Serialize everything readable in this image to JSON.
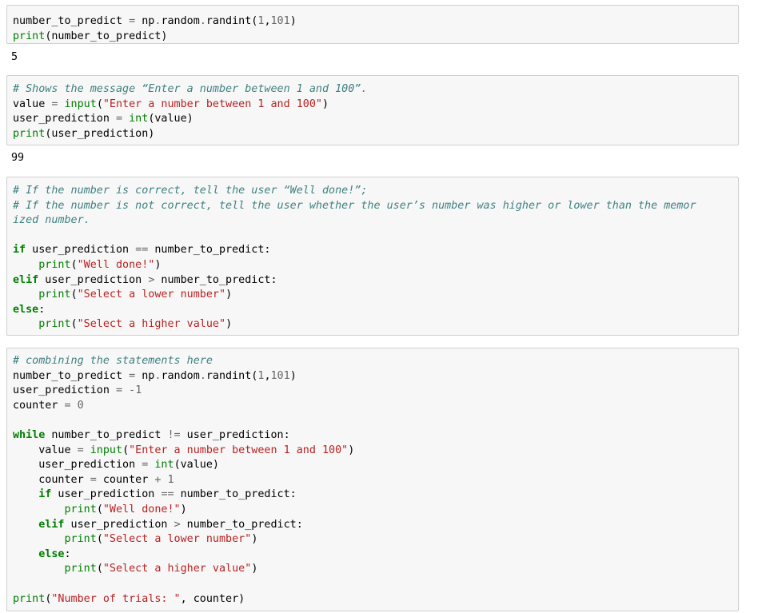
{
  "cells": [
    {
      "lines": [
        [
          {
            "t": "n",
            "v": "number_to_predict "
          },
          {
            "t": "o",
            "v": "="
          },
          {
            "t": "n",
            "v": " np"
          },
          {
            "t": "o",
            "v": "."
          },
          {
            "t": "n",
            "v": "random"
          },
          {
            "t": "o",
            "v": "."
          },
          {
            "t": "n",
            "v": "randint("
          },
          {
            "t": "m",
            "v": "1"
          },
          {
            "t": "n",
            "v": ","
          },
          {
            "t": "m",
            "v": "101"
          },
          {
            "t": "n",
            "v": ")"
          }
        ],
        [
          {
            "t": "b",
            "v": "print"
          },
          {
            "t": "n",
            "v": "(number_to_predict)"
          }
        ]
      ],
      "output": "5"
    },
    {
      "lines": [
        [
          {
            "t": "c",
            "v": "# Shows the message “Enter a number between 1 and 100”."
          }
        ],
        [
          {
            "t": "n",
            "v": "value "
          },
          {
            "t": "o",
            "v": "="
          },
          {
            "t": "n",
            "v": " "
          },
          {
            "t": "b",
            "v": "input"
          },
          {
            "t": "n",
            "v": "("
          },
          {
            "t": "s",
            "v": "\"Enter a number between 1 and 100\""
          },
          {
            "t": "n",
            "v": ")"
          }
        ],
        [
          {
            "t": "n",
            "v": "user_prediction "
          },
          {
            "t": "o",
            "v": "="
          },
          {
            "t": "n",
            "v": " "
          },
          {
            "t": "b",
            "v": "int"
          },
          {
            "t": "n",
            "v": "(value)"
          }
        ],
        [
          {
            "t": "b",
            "v": "print"
          },
          {
            "t": "n",
            "v": "(user_prediction)"
          }
        ]
      ],
      "output": "99"
    },
    {
      "lines": [
        [
          {
            "t": "c",
            "v": "# If the number is correct, tell the user “Well done!”;"
          }
        ],
        [
          {
            "t": "c",
            "v": "# If the number is not correct, tell the user whether the user’s number was higher or lower than the memor"
          }
        ],
        [
          {
            "t": "c",
            "v": "ized number."
          }
        ],
        [],
        [
          {
            "t": "k",
            "v": "if"
          },
          {
            "t": "n",
            "v": " user_prediction "
          },
          {
            "t": "o",
            "v": "=="
          },
          {
            "t": "n",
            "v": " number_to_predict:"
          }
        ],
        [
          {
            "t": "n",
            "v": "    "
          },
          {
            "t": "b",
            "v": "print"
          },
          {
            "t": "n",
            "v": "("
          },
          {
            "t": "s",
            "v": "\"Well done!\""
          },
          {
            "t": "n",
            "v": ")"
          }
        ],
        [
          {
            "t": "k",
            "v": "elif"
          },
          {
            "t": "n",
            "v": " user_prediction "
          },
          {
            "t": "o",
            "v": ">"
          },
          {
            "t": "n",
            "v": " number_to_predict:"
          }
        ],
        [
          {
            "t": "n",
            "v": "    "
          },
          {
            "t": "b",
            "v": "print"
          },
          {
            "t": "n",
            "v": "("
          },
          {
            "t": "s",
            "v": "\"Select a lower number\""
          },
          {
            "t": "n",
            "v": ")"
          }
        ],
        [
          {
            "t": "k",
            "v": "else"
          },
          {
            "t": "n",
            "v": ":"
          }
        ],
        [
          {
            "t": "n",
            "v": "    "
          },
          {
            "t": "b",
            "v": "print"
          },
          {
            "t": "n",
            "v": "("
          },
          {
            "t": "s",
            "v": "\"Select a higher value\""
          },
          {
            "t": "n",
            "v": ")"
          }
        ]
      ],
      "output": null
    },
    {
      "lines": [
        [
          {
            "t": "c",
            "v": "# combining the statements here"
          }
        ],
        [
          {
            "t": "n",
            "v": "number_to_predict "
          },
          {
            "t": "o",
            "v": "="
          },
          {
            "t": "n",
            "v": " np"
          },
          {
            "t": "o",
            "v": "."
          },
          {
            "t": "n",
            "v": "random"
          },
          {
            "t": "o",
            "v": "."
          },
          {
            "t": "n",
            "v": "randint("
          },
          {
            "t": "m",
            "v": "1"
          },
          {
            "t": "n",
            "v": ","
          },
          {
            "t": "m",
            "v": "101"
          },
          {
            "t": "n",
            "v": ")"
          }
        ],
        [
          {
            "t": "n",
            "v": "user_prediction "
          },
          {
            "t": "o",
            "v": "="
          },
          {
            "t": "n",
            "v": " "
          },
          {
            "t": "o",
            "v": "-"
          },
          {
            "t": "m",
            "v": "1"
          }
        ],
        [
          {
            "t": "n",
            "v": "counter "
          },
          {
            "t": "o",
            "v": "="
          },
          {
            "t": "n",
            "v": " "
          },
          {
            "t": "m",
            "v": "0"
          }
        ],
        [],
        [
          {
            "t": "k",
            "v": "while"
          },
          {
            "t": "n",
            "v": " number_to_predict "
          },
          {
            "t": "o",
            "v": "!="
          },
          {
            "t": "n",
            "v": " user_prediction:"
          }
        ],
        [
          {
            "t": "n",
            "v": "    value "
          },
          {
            "t": "o",
            "v": "="
          },
          {
            "t": "n",
            "v": " "
          },
          {
            "t": "b",
            "v": "input"
          },
          {
            "t": "n",
            "v": "("
          },
          {
            "t": "s",
            "v": "\"Enter a number between 1 and 100\""
          },
          {
            "t": "n",
            "v": ")"
          }
        ],
        [
          {
            "t": "n",
            "v": "    user_prediction "
          },
          {
            "t": "o",
            "v": "="
          },
          {
            "t": "n",
            "v": " "
          },
          {
            "t": "b",
            "v": "int"
          },
          {
            "t": "n",
            "v": "(value)"
          }
        ],
        [
          {
            "t": "n",
            "v": "    counter "
          },
          {
            "t": "o",
            "v": "="
          },
          {
            "t": "n",
            "v": " counter "
          },
          {
            "t": "o",
            "v": "+"
          },
          {
            "t": "n",
            "v": " "
          },
          {
            "t": "m",
            "v": "1"
          }
        ],
        [
          {
            "t": "n",
            "v": "    "
          },
          {
            "t": "k",
            "v": "if"
          },
          {
            "t": "n",
            "v": " user_prediction "
          },
          {
            "t": "o",
            "v": "=="
          },
          {
            "t": "n",
            "v": " number_to_predict:"
          }
        ],
        [
          {
            "t": "n",
            "v": "        "
          },
          {
            "t": "b",
            "v": "print"
          },
          {
            "t": "n",
            "v": "("
          },
          {
            "t": "s",
            "v": "\"Well done!\""
          },
          {
            "t": "n",
            "v": ")"
          }
        ],
        [
          {
            "t": "n",
            "v": "    "
          },
          {
            "t": "k",
            "v": "elif"
          },
          {
            "t": "n",
            "v": " user_prediction "
          },
          {
            "t": "o",
            "v": ">"
          },
          {
            "t": "n",
            "v": " number_to_predict:"
          }
        ],
        [
          {
            "t": "n",
            "v": "        "
          },
          {
            "t": "b",
            "v": "print"
          },
          {
            "t": "n",
            "v": "("
          },
          {
            "t": "s",
            "v": "\"Select a lower number\""
          },
          {
            "t": "n",
            "v": ")"
          }
        ],
        [
          {
            "t": "n",
            "v": "    "
          },
          {
            "t": "k",
            "v": "else"
          },
          {
            "t": "n",
            "v": ":"
          }
        ],
        [
          {
            "t": "n",
            "v": "        "
          },
          {
            "t": "b",
            "v": "print"
          },
          {
            "t": "n",
            "v": "("
          },
          {
            "t": "s",
            "v": "\"Select a higher value\""
          },
          {
            "t": "n",
            "v": ")"
          }
        ],
        [],
        [
          {
            "t": "b",
            "v": "print"
          },
          {
            "t": "n",
            "v": "("
          },
          {
            "t": "s",
            "v": "\"Number of trials: \""
          },
          {
            "t": "n",
            "v": ", counter)"
          }
        ]
      ],
      "output": null
    }
  ]
}
